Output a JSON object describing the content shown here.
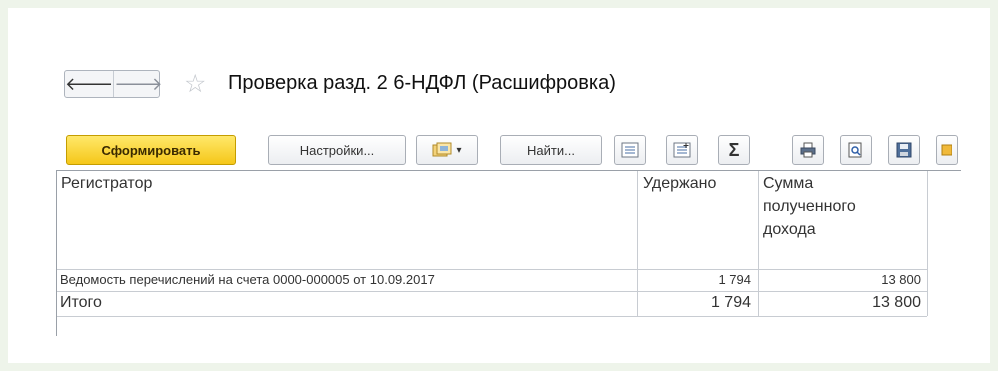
{
  "window": {
    "title": "Проверка разд. 2 6-НДФЛ (Расшифровка)"
  },
  "nav": {
    "back_glyph": "🡐",
    "forward_glyph": "🡒",
    "star_glyph": "☆"
  },
  "toolbar": {
    "generate_label": "Сформировать",
    "settings_label": "Настройки...",
    "find_label": "Найти...",
    "sum_glyph": "Σ",
    "dropdown_glyph": "▾",
    "icons": [
      "variant-icon",
      "collapse-groups-icon",
      "expand-groups-icon",
      "sum-icon",
      "print-icon",
      "preview-icon",
      "save-icon",
      "extra-icon"
    ]
  },
  "report": {
    "columns": [
      "Регистратор",
      "Удержано",
      "Сумма полученного дохода"
    ],
    "column_lines": [
      "Сумма",
      "полученного",
      "дохода"
    ],
    "rows": [
      {
        "registrar": "Ведомость перечислений на счета 0000-000005 от 10.09.2017",
        "withheld": "1 794",
        "income": "13 800"
      }
    ],
    "total": {
      "label": "Итого",
      "withheld": "1 794",
      "income": "13 800"
    }
  },
  "colors": {
    "primary_button": "#f5c719",
    "background": "#eef4ea",
    "grid_lines": "#c8ccd2"
  }
}
